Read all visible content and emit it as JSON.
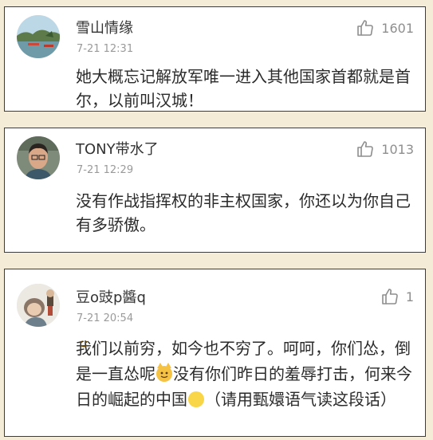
{
  "comments": [
    {
      "username": "雪山情缘",
      "time": "7-21 12:31",
      "likes": "1601",
      "avatar_icon": "lake-landscape-avatar",
      "text": "她大概忘记解放军唯一进入其他国家首都就是首尔，以前叫汉城！"
    },
    {
      "username": "TONY带水了",
      "time": "7-21 12:29",
      "likes": "1013",
      "avatar_icon": "man-portrait-avatar",
      "text": "没有作战指挥权的非主权国家，你还以为你自己有多骄傲。"
    },
    {
      "username": "豆o豉p醬q",
      "time": "7-21 20:54",
      "likes": "1",
      "avatar_icon": "anime-figure-avatar",
      "text_part1": "我们以前穷，如今也不穷了。呵呵，你们怂，倒是一直怂呢",
      "emoji1": "cat-face-emoji",
      "text_part2": "没有你们昨日的羞辱打击，何来今日的崛起的中国",
      "emoji2": "smile-emoji",
      "text_part3": "（请用甄嬛语气读这段话）"
    }
  ],
  "like_icon": "thumbs-up-icon",
  "colors": {
    "background": "#f4ecd6",
    "card": "#ffffff",
    "border": "#3c3c3c",
    "meta": "#9a9a9a"
  }
}
